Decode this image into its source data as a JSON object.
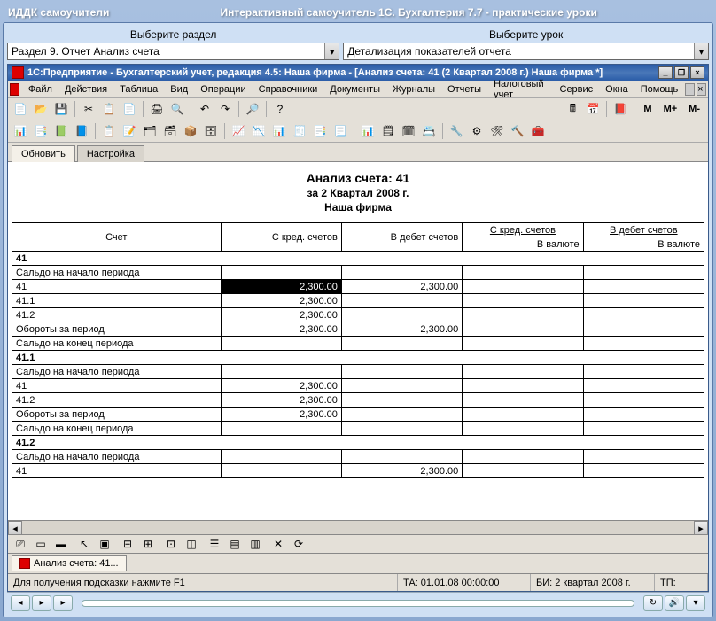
{
  "outer": {
    "app_badge": "ИДДК самоучители",
    "title": "Интерактивный самоучитель 1С. Бухгалтерия 7.7 - практические уроки"
  },
  "selectors": {
    "left_label": "Выберите раздел",
    "left_value": "Раздел 9. Отчет Анализ счета",
    "right_label": "Выберите урок",
    "right_value": "Детализация показателей отчета"
  },
  "inner": {
    "title": "1С:Предприятие - Бухгалтерский учет, редакция 4.5: Наша фирма - [Анализ счета: 41 (2 Квартал 2008 г.) Наша фирма  *]"
  },
  "menu": {
    "items": [
      "Файл",
      "Действия",
      "Таблица",
      "Вид",
      "Операции",
      "Справочники",
      "Документы",
      "Журналы",
      "Отчеты",
      "Налоговый учет",
      "Сервис",
      "Окна",
      "Помощь"
    ]
  },
  "mbuttons": [
    "M",
    "M+",
    "M-"
  ],
  "tabs": {
    "t1": "Обновить",
    "t2": "Настройка"
  },
  "report": {
    "title": "Анализ счета: 41",
    "period": "за 2 Квартал 2008 г.",
    "firm": "Наша фирма",
    "headers": {
      "c0": "Счет",
      "c1": "С кред. счетов",
      "c2": "В дебет счетов",
      "c3": "С кред. счетов",
      "c4": "В дебет счетов",
      "sub": "В валюте"
    },
    "rows": [
      {
        "t": "sec",
        "c0": "41"
      },
      {
        "t": "r",
        "c0": "Сальдо на начало периода"
      },
      {
        "t": "r",
        "c0": "41",
        "c1": "2,300.00",
        "c2": "2,300.00",
        "sel": true
      },
      {
        "t": "r",
        "c0": "41.1",
        "c1": "2,300.00"
      },
      {
        "t": "r",
        "c0": "41.2",
        "c1": "2,300.00"
      },
      {
        "t": "r",
        "c0": "Обороты за период",
        "c1": "2,300.00",
        "c2": "2,300.00"
      },
      {
        "t": "r",
        "c0": "Сальдо на конец периода"
      },
      {
        "t": "sec",
        "c0": "41.1"
      },
      {
        "t": "r",
        "c0": "Сальдо на начало периода"
      },
      {
        "t": "r",
        "c0": "41",
        "c1": "2,300.00"
      },
      {
        "t": "r",
        "c0": "41.2",
        "c1": "2,300.00"
      },
      {
        "t": "r",
        "c0": "Обороты за период",
        "c1": "2,300.00"
      },
      {
        "t": "r",
        "c0": "Сальдо на конец периода"
      },
      {
        "t": "sec",
        "c0": "41.2"
      },
      {
        "t": "r",
        "c0": "Сальдо на начало периода"
      },
      {
        "t": "r",
        "c0": "41",
        "c2": "2,300.00"
      }
    ]
  },
  "doc_tab": "Анализ счета: 41...",
  "status": {
    "hint": "Для получения подсказки нажмите F1",
    "ta": "ТА: 01.01.08  00:00:00",
    "bi": "БИ: 2 квартал 2008 г.",
    "tp": "ТП:"
  }
}
